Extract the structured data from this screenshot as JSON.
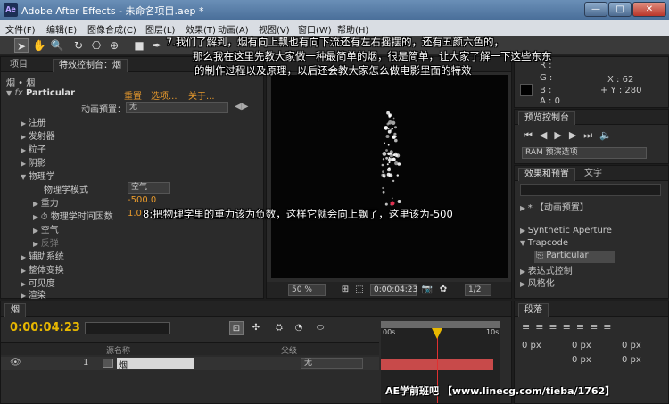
{
  "window": {
    "title": "Adobe After Effects - 未命名项目.aep *",
    "app_icon": "Ae",
    "min_label": "—",
    "max_label": "□",
    "close_label": "✕"
  },
  "menu": [
    "文件(F)",
    "编辑(E)",
    "图像合成(C)",
    "图层(L)",
    "效果(T)",
    "动画(A)",
    "视图(V)",
    "窗口(W)",
    "帮助(H)"
  ],
  "toolbar": {
    "tools": [
      {
        "name": "selection-tool-icon",
        "glyph": "➤"
      },
      {
        "name": "hand-tool-icon",
        "glyph": "✋"
      },
      {
        "name": "zoom-tool-icon",
        "glyph": "🔍"
      },
      {
        "name": "rotate-tool-icon",
        "glyph": "↻"
      },
      {
        "name": "camera-tool-icon",
        "glyph": "⎔"
      },
      {
        "name": "pan-behind-tool-icon",
        "glyph": "⊕"
      },
      {
        "name": "rectangle-tool-icon",
        "glyph": "■"
      },
      {
        "name": "pen-tool-icon",
        "glyph": "✒"
      }
    ]
  },
  "effect_controls": {
    "tab_project": "项目",
    "tab_effects": "特效控制台：烟",
    "layer_path": "烟 • 烟",
    "effect_name": "Particular",
    "reset": "重置",
    "options": "选项...",
    "about": "关于...",
    "preset_label": "动画预置：",
    "preset_value": "无",
    "groups": [
      "注册",
      "发射器",
      "粒子",
      "阴影"
    ],
    "physics": "物理学",
    "physics_model_label": "物理学模式",
    "physics_model_value": "空气",
    "gravity_label": "重力",
    "gravity_value": "-500.0",
    "time_factor_label": "物理学时间因数",
    "time_factor_value": "1.0",
    "air": "空气",
    "bounce": "反弹",
    "groups2": [
      "辅助系统",
      "整体变换",
      "可见度",
      "渲染"
    ]
  },
  "comp": {
    "zoom": "50 %",
    "timecode": "0:00:04:23",
    "resolution": "1/2"
  },
  "info": {
    "r_label": "R :",
    "g_label": "G :",
    "b_label": "B :",
    "a_label": "A : 0",
    "x": "X : 62",
    "y": "+ Y : 280"
  },
  "preview": {
    "title": "预览控制台",
    "ram": "RAM 预演选项"
  },
  "effects_presets": {
    "tab1": "效果和预置",
    "tab2": "文字",
    "search_placeholder": "",
    "items": [
      "* 【动画预置】",
      "Synthetic Aperture",
      "Trapcode",
      "Particular",
      "表达式控制",
      "风格化"
    ]
  },
  "paragraph": {
    "title": "段落",
    "fields": [
      "0 px",
      "0 px",
      "0 px",
      "0 px",
      "0 px"
    ]
  },
  "timeline": {
    "tab": "烟",
    "timecode": "0:00:04:23",
    "search_placeholder": "",
    "col_name": "源名称",
    "col_parent": "父级",
    "ruler_start": "00s",
    "ruler_end": "10s",
    "layer_num": "1",
    "layer_name": "烟",
    "parent_value": "无"
  },
  "annotations": {
    "note7_line1": "7.我们了解到，烟有向上飘也有向下流还有左右摇摆的，还有五颜六色的，",
    "note7_line2": "那么我在这里先教大家做一种最简单的烟，很是简单，让大家了解一下这些东东",
    "note7_line3": "的制作过程以及原理，以后还会教大家怎么做电影里面的特效",
    "note8": "8:把物理学里的重力该为负数，这样它就会向上飘了，这里该为-500",
    "watermark": "AE学前班吧 【www.linecg.com/tieba/1762】"
  },
  "colors": {
    "accent_orange": "#e89a2c",
    "layer_bar": "#c84a4a",
    "playhead": "#e03030"
  }
}
